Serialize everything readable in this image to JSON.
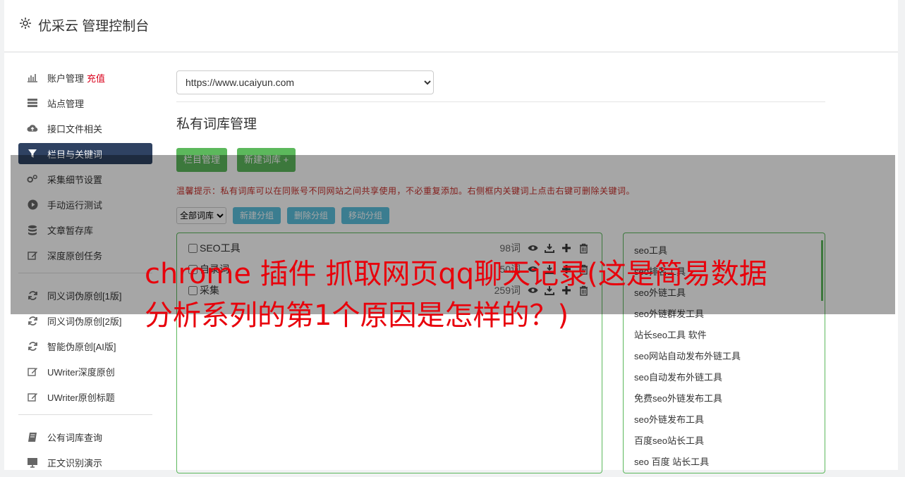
{
  "header": {
    "title": "优采云 管理控制台"
  },
  "sidebar": {
    "group1": [
      {
        "label": "账户管理",
        "extra": "充值"
      },
      {
        "label": "站点管理"
      },
      {
        "label": "接口文件相关"
      },
      {
        "label": "栏目与关键词"
      },
      {
        "label": "采集细节设置"
      },
      {
        "label": "手动运行测试"
      },
      {
        "label": "文章暂存库"
      },
      {
        "label": "深度原创任务"
      }
    ],
    "group2": [
      {
        "label": "同义词伪原创[1版]"
      },
      {
        "label": "同义词伪原创[2版]"
      },
      {
        "label": "智能伪原创[AI版]"
      },
      {
        "label": "UWriter深度原创"
      },
      {
        "label": "UWriter原创标题"
      }
    ],
    "group3": [
      {
        "label": "公有词库查询"
      },
      {
        "label": "正文识别演示"
      }
    ]
  },
  "main": {
    "site_select": "https://www.ucaiyun.com",
    "title": "私有词库管理",
    "btn_column": "栏目管理",
    "btn_new_lib": "新建词库 +",
    "tip": "温馨提示：私有词库可以在同账号不同网站之间共享使用，不必重复添加。右侧框内关键词上点击右键可删除关键词。",
    "filter_select": "全部词库",
    "btn_new_group": "新建分组",
    "btn_delete_group": "删除分组",
    "btn_move_group": "移动分组",
    "libraries": [
      {
        "name": "SEO工具",
        "count": "98词"
      },
      {
        "name": "自录词",
        "count": "50词"
      },
      {
        "name": "采集",
        "count": "259词"
      }
    ],
    "keywords": [
      "seo工具",
      "seo排名工具",
      "seo外链工具",
      "seo外链群发工具",
      "站长seo工具 软件",
      "seo网站自动发布外链工具",
      "seo自动发布外链工具",
      "免费seo外链发布工具",
      "seo外链发布工具",
      "百度seo站长工具",
      "seo 百度 站长工具"
    ]
  },
  "overlay": {
    "headline": "chrome 插件 抓取网页qq聊天记录(这是简易数据分析系列的第1个原因是怎样的？)"
  }
}
